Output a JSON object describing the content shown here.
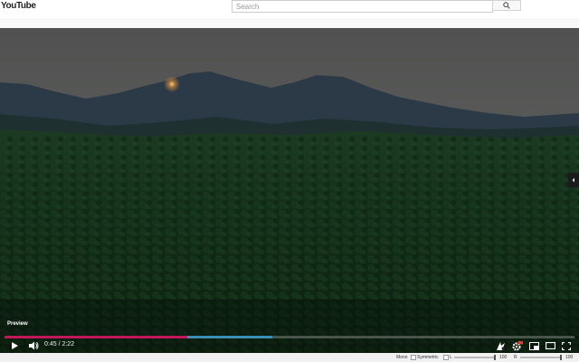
{
  "header": {
    "logo_text": "YouTube",
    "search": {
      "placeholder": "Search",
      "value": ""
    },
    "search_icon": "magnifier-icon"
  },
  "player": {
    "preview_label": "Preview",
    "current_time": "0:45",
    "duration": "2:22",
    "time_display": "0:45 / 2:22",
    "progress": {
      "played_percent": 32,
      "loaded_percent": 47
    },
    "colors": {
      "played": "#c2185b",
      "loaded": "#3a8fb4"
    },
    "controls": {
      "left": [
        "play-icon",
        "volume-icon"
      ],
      "right": [
        "audio-extension-icon",
        "hd-settings-icon",
        "miniplayer-icon",
        "theater-mode-icon",
        "fullscreen-icon"
      ]
    },
    "side_panel_icon": "chevron-left-icon"
  },
  "audio_bar": {
    "mono_label": "Mono",
    "symmetric_label": "Symmetric",
    "left_label": "L",
    "left_value": "100",
    "right_label": "R",
    "right_value": "100"
  }
}
